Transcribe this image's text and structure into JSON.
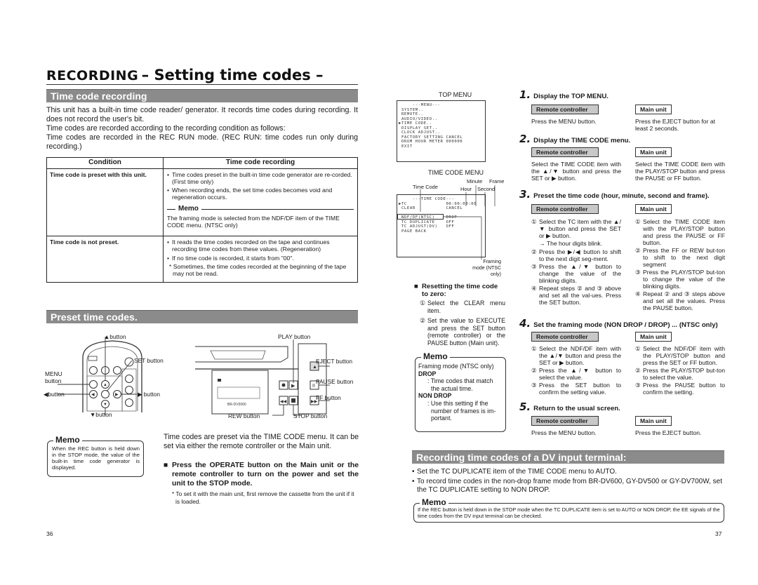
{
  "header": {
    "section": "RECORDING",
    "title": "– Setting time codes –"
  },
  "left_page": {
    "section1": {
      "title": "Time code recording",
      "intro": [
        "This unit has a built-in time code reader/ generator. It records time codes during recording. It does not record the user's bit.",
        "Time codes are recorded according to the recording condition as follows:",
        "Time codes are recorded in the REC RUN mode. (REC RUN: time codes run only during recording.)"
      ],
      "table": {
        "headers": [
          "Condition",
          "Time code recording"
        ],
        "rows": [
          {
            "condition": "Time code is preset with this unit.",
            "bullets": [
              "Time codes preset in the built-in time code generator are re-corded. (First time only)",
              "When recording ends, the set time codes becomes void and regeneration occurs."
            ],
            "memo_title": "Memo",
            "memo_text": "The framing mode is selected from the NDF/DF item of the TIME CODE menu. (NTSC only)"
          },
          {
            "condition": "Time code is not preset.",
            "bullets": [
              "It reads the time codes recorded on the tape and continues recording time codes from these values. (Regeneration)",
              "If no time code is recorded, it starts from \"00\"."
            ],
            "note": "* Sometimes, the time codes recorded at the beginning of the tape may not be read."
          }
        ]
      }
    },
    "section2": {
      "title": "Preset time codes.",
      "remote_labels": {
        "up": "▲button",
        "set": "SET button",
        "menu": "MENU button",
        "left": "◀button",
        "right": "▶ button",
        "down": "▼button"
      },
      "unit_labels": {
        "play": "PLAY button",
        "eject": "EJECT button",
        "pause": "PAUSE button",
        "ff": "FF button",
        "rew": "REW button",
        "stop": "STOP button",
        "model": "BR-DV3000"
      },
      "memo": {
        "title": "Memo",
        "text": "When the REC button is held down in the STOP mode, the value of the built-in time code generator is displayed."
      },
      "description": "Time codes are preset via the TIME CODE menu. It can be set via either the remote controller or the Main unit.",
      "instruction": "Press the OPERATE button on the Main unit or the remote controller to turn on the power and set the unit to the STOP mode.",
      "instruction_note": "* To set it with the main unit, first remove the cassette from the unit if it is loaded."
    },
    "page_number": "36"
  },
  "right_page": {
    "top_menu": {
      "title": "TOP MENU",
      "screen": "     ---MENU---\n SYSTEM..\n REMOTE..\n AUDIO/VIDEO..\n▶TIME CODE..\n DISPLAY SET..\n CLOCK ADJUST..\n FACTORY SETTING CANCEL\n DRUM HOUR METER 000000\n EXIT"
    },
    "tc_menu": {
      "title": "TIME CODE MENU",
      "labels": {
        "time_code": "Time Code",
        "hour": "Hour",
        "minute": "Minute",
        "second": "Second",
        "frame": "Frame",
        "framing_mode": "Framing mode (NTSC only)"
      },
      "screen": "     ---TIME CODE---\n▶TC              00:00:00:00\n CLEAR           CANCEL\n\n NDF/DF(NTSC)    DROP\n TC DUPLICATE    OFF\n TC ADJUST(DV)   OFF\n PAGE BACK"
    },
    "reset": {
      "title": "Resetting the time code to zero:",
      "steps": [
        "Select the CLEAR menu item.",
        "Set the value to EXECUTE and press the SET button (remote controller) or the PAUSE button (Main unit)."
      ]
    },
    "framing_memo": {
      "title": "Memo",
      "intro": "Framing mode (NTSC only)",
      "items": [
        {
          "term": "DROP",
          "desc": ": Time codes that match the actual time."
        },
        {
          "term": "NON DROP",
          "desc": ": Use this setting if the number of frames is im-portant."
        }
      ]
    },
    "steps": [
      {
        "num": "1.",
        "title": "Display the TOP MENU.",
        "remote_label": "Remote controller",
        "main_label": "Main unit",
        "remote": [
          "Press the MENU button."
        ],
        "main": [
          "Press the EJECT button for at least 2 seconds."
        ]
      },
      {
        "num": "2.",
        "title": "Display the TIME CODE menu.",
        "remote_label": "Remote controller",
        "main_label": "Main unit",
        "remote": [
          "Select the TIME CODE item with the ▲/▼ button and press the SET or ▶ button."
        ],
        "main": [
          "Select the TIME CODE item with the PLAY/STOP button and press the PAUSE or FF button."
        ]
      },
      {
        "num": "3.",
        "title": "Preset the time code (hour, minute, second and frame).",
        "remote_label": "Remote controller",
        "main_label": "Main unit",
        "remote": [
          "Select the TC item with the ▲/▼ button and press the SET or ▶ button.",
          "→ The hour digits blink.",
          "Press the ▶/◀ button to shift to the next digit seg-ment.",
          "Press the ▲/▼ button to change the value of the blinking digits.",
          "Repeat steps ② and ③ above and set all the val-ues. Press the SET button."
        ],
        "main": [
          "Select the TIME CODE item with the PLAY/STOP button and press the PAUSE or FF button.",
          "Press the FF or REW but-ton to shift to the next digit segment",
          "Press the PLAY/STOP but-ton to change the value of the blinking digits.",
          "Repeat ② and ③ steps above and set all the values. Press the PAUSE button."
        ]
      },
      {
        "num": "4.",
        "title": "Set the framing mode (NON DROP / DROP) ... (NTSC only)",
        "remote_label": "Remote controller",
        "main_label": "Main unit",
        "remote": [
          "Select the NDF/DF item with the ▲/▼ button and press the SET or ▶ button.",
          "Press the ▲/▼ button to select the value.",
          "Press the SET button to confirm the setting value."
        ],
        "main": [
          "Select the NDF/DF item with the PLAY/STOP button and press the SET or FF button.",
          "Press the PLAY/STOP but-ton to select the value.",
          "Press the PAUSE button to confirm the setting."
        ]
      },
      {
        "num": "5.",
        "title": "Return to the usual screen.",
        "remote_label": "Remote controller",
        "main_label": "Main unit",
        "remote": [
          "Press the MENU button."
        ],
        "main": [
          "Press the EJECT button."
        ]
      }
    ],
    "dv_section": {
      "title": "Recording time codes of a DV input terminal:",
      "bullets": [
        "Set the TC DUPLICATE item of the TIME CODE menu to AUTO.",
        "To record time codes in the non-drop frame mode from BR-DV600, GY-DV500 or GY-DV700W, set the TC DUPLICATE setting to NON DROP."
      ],
      "memo_title": "Memo",
      "memo_text": "If the REC button is held down in the STOP mode when the TC DUPLICATE item is set to AUTO or NON DROP, the EE signals of the time codes from the DV input terminal can be checked."
    },
    "page_number": "37"
  }
}
